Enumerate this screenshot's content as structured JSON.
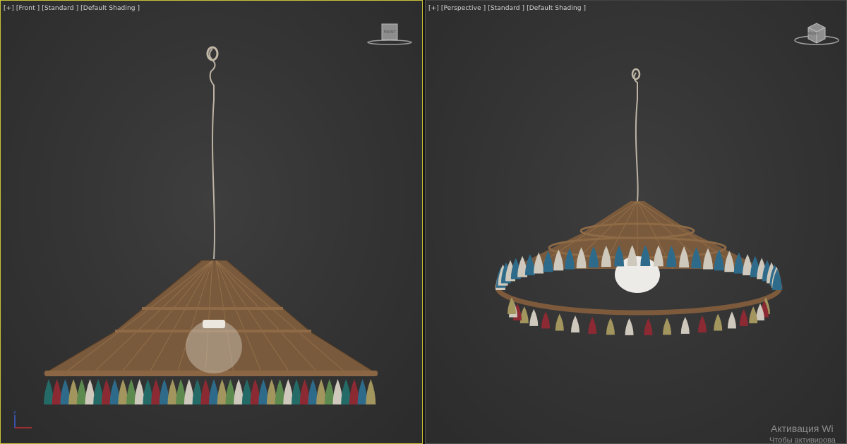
{
  "viewports": {
    "left": {
      "menu": "[+]",
      "view": "[Front ]",
      "standard": "[Standard ]",
      "shading": "[Default Shading ]",
      "cube_label": "FRONT"
    },
    "right": {
      "menu": "[+]",
      "view": "[Perspective ]",
      "standard": "[Standard ]",
      "shading": "[Default Shading ]",
      "cube_label": "FRONT"
    }
  },
  "watermark": {
    "line1": "Активация Wi",
    "line2": "Чтобы активирова"
  },
  "colors": {
    "active_border": "#c9c23a",
    "rattan": "#7d5a3c",
    "tassels": [
      "#8c2a33",
      "#246b68",
      "#cfc9bd",
      "#5d8a4e",
      "#a2955e",
      "#2e6b8a"
    ]
  }
}
